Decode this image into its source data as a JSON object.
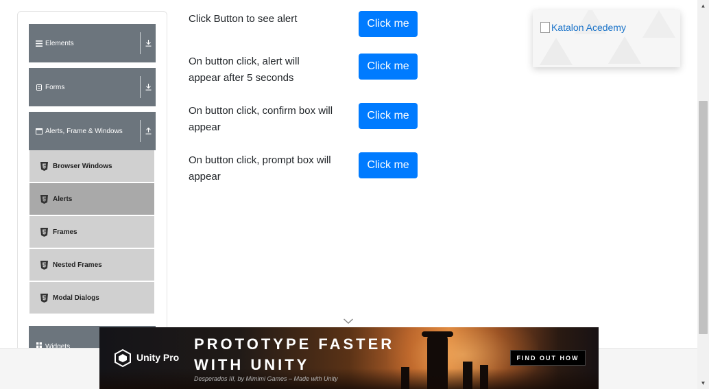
{
  "sidebar": {
    "groups": [
      {
        "label": "Elements",
        "icon": "list-icon",
        "toggle_icon": "download-arrow-icon"
      },
      {
        "label": "Forms",
        "icon": "form-icon",
        "toggle_icon": "download-arrow-icon"
      },
      {
        "label": "Alerts, Frame & Windows",
        "icon": "window-icon",
        "toggle_icon": "upload-arrow-icon"
      },
      {
        "label": "Widgets",
        "icon": "grid-icon"
      }
    ],
    "subitems": [
      {
        "label": "Browser Windows",
        "icon": "html5-icon",
        "active": false
      },
      {
        "label": "Alerts",
        "icon": "html5-icon",
        "active": true
      },
      {
        "label": "Frames",
        "icon": "html5-icon",
        "active": false
      },
      {
        "label": "Nested Frames",
        "icon": "html5-icon",
        "active": false
      },
      {
        "label": "Modal Dialogs",
        "icon": "html5-icon",
        "active": false
      }
    ]
  },
  "main": {
    "rows": [
      {
        "text": "Click Button to see alert",
        "button": "Click me"
      },
      {
        "text": "On button click, alert will appear after 5 seconds",
        "button": "Click me"
      },
      {
        "text": "On button click, confirm box will appear",
        "button": "Click me"
      },
      {
        "text": "On button click, prompt box will appear",
        "button": "Click me"
      }
    ]
  },
  "promo": {
    "alt_text": "Katalon Acedemy"
  },
  "ad": {
    "brand": "Unity Pro",
    "headline_line1": "PROTOTYPE FASTER",
    "headline_line2": "WITH UNITY",
    "caption": "Desperados III, by Mimimi Games – Made with Unity",
    "cta": "FIND OUT HOW"
  },
  "colors": {
    "primary_button": "#007bff",
    "sidebar_group": "#6c757d",
    "sidebar_subitem": "#d0d0d0",
    "sidebar_active": "#a9a9a9"
  }
}
